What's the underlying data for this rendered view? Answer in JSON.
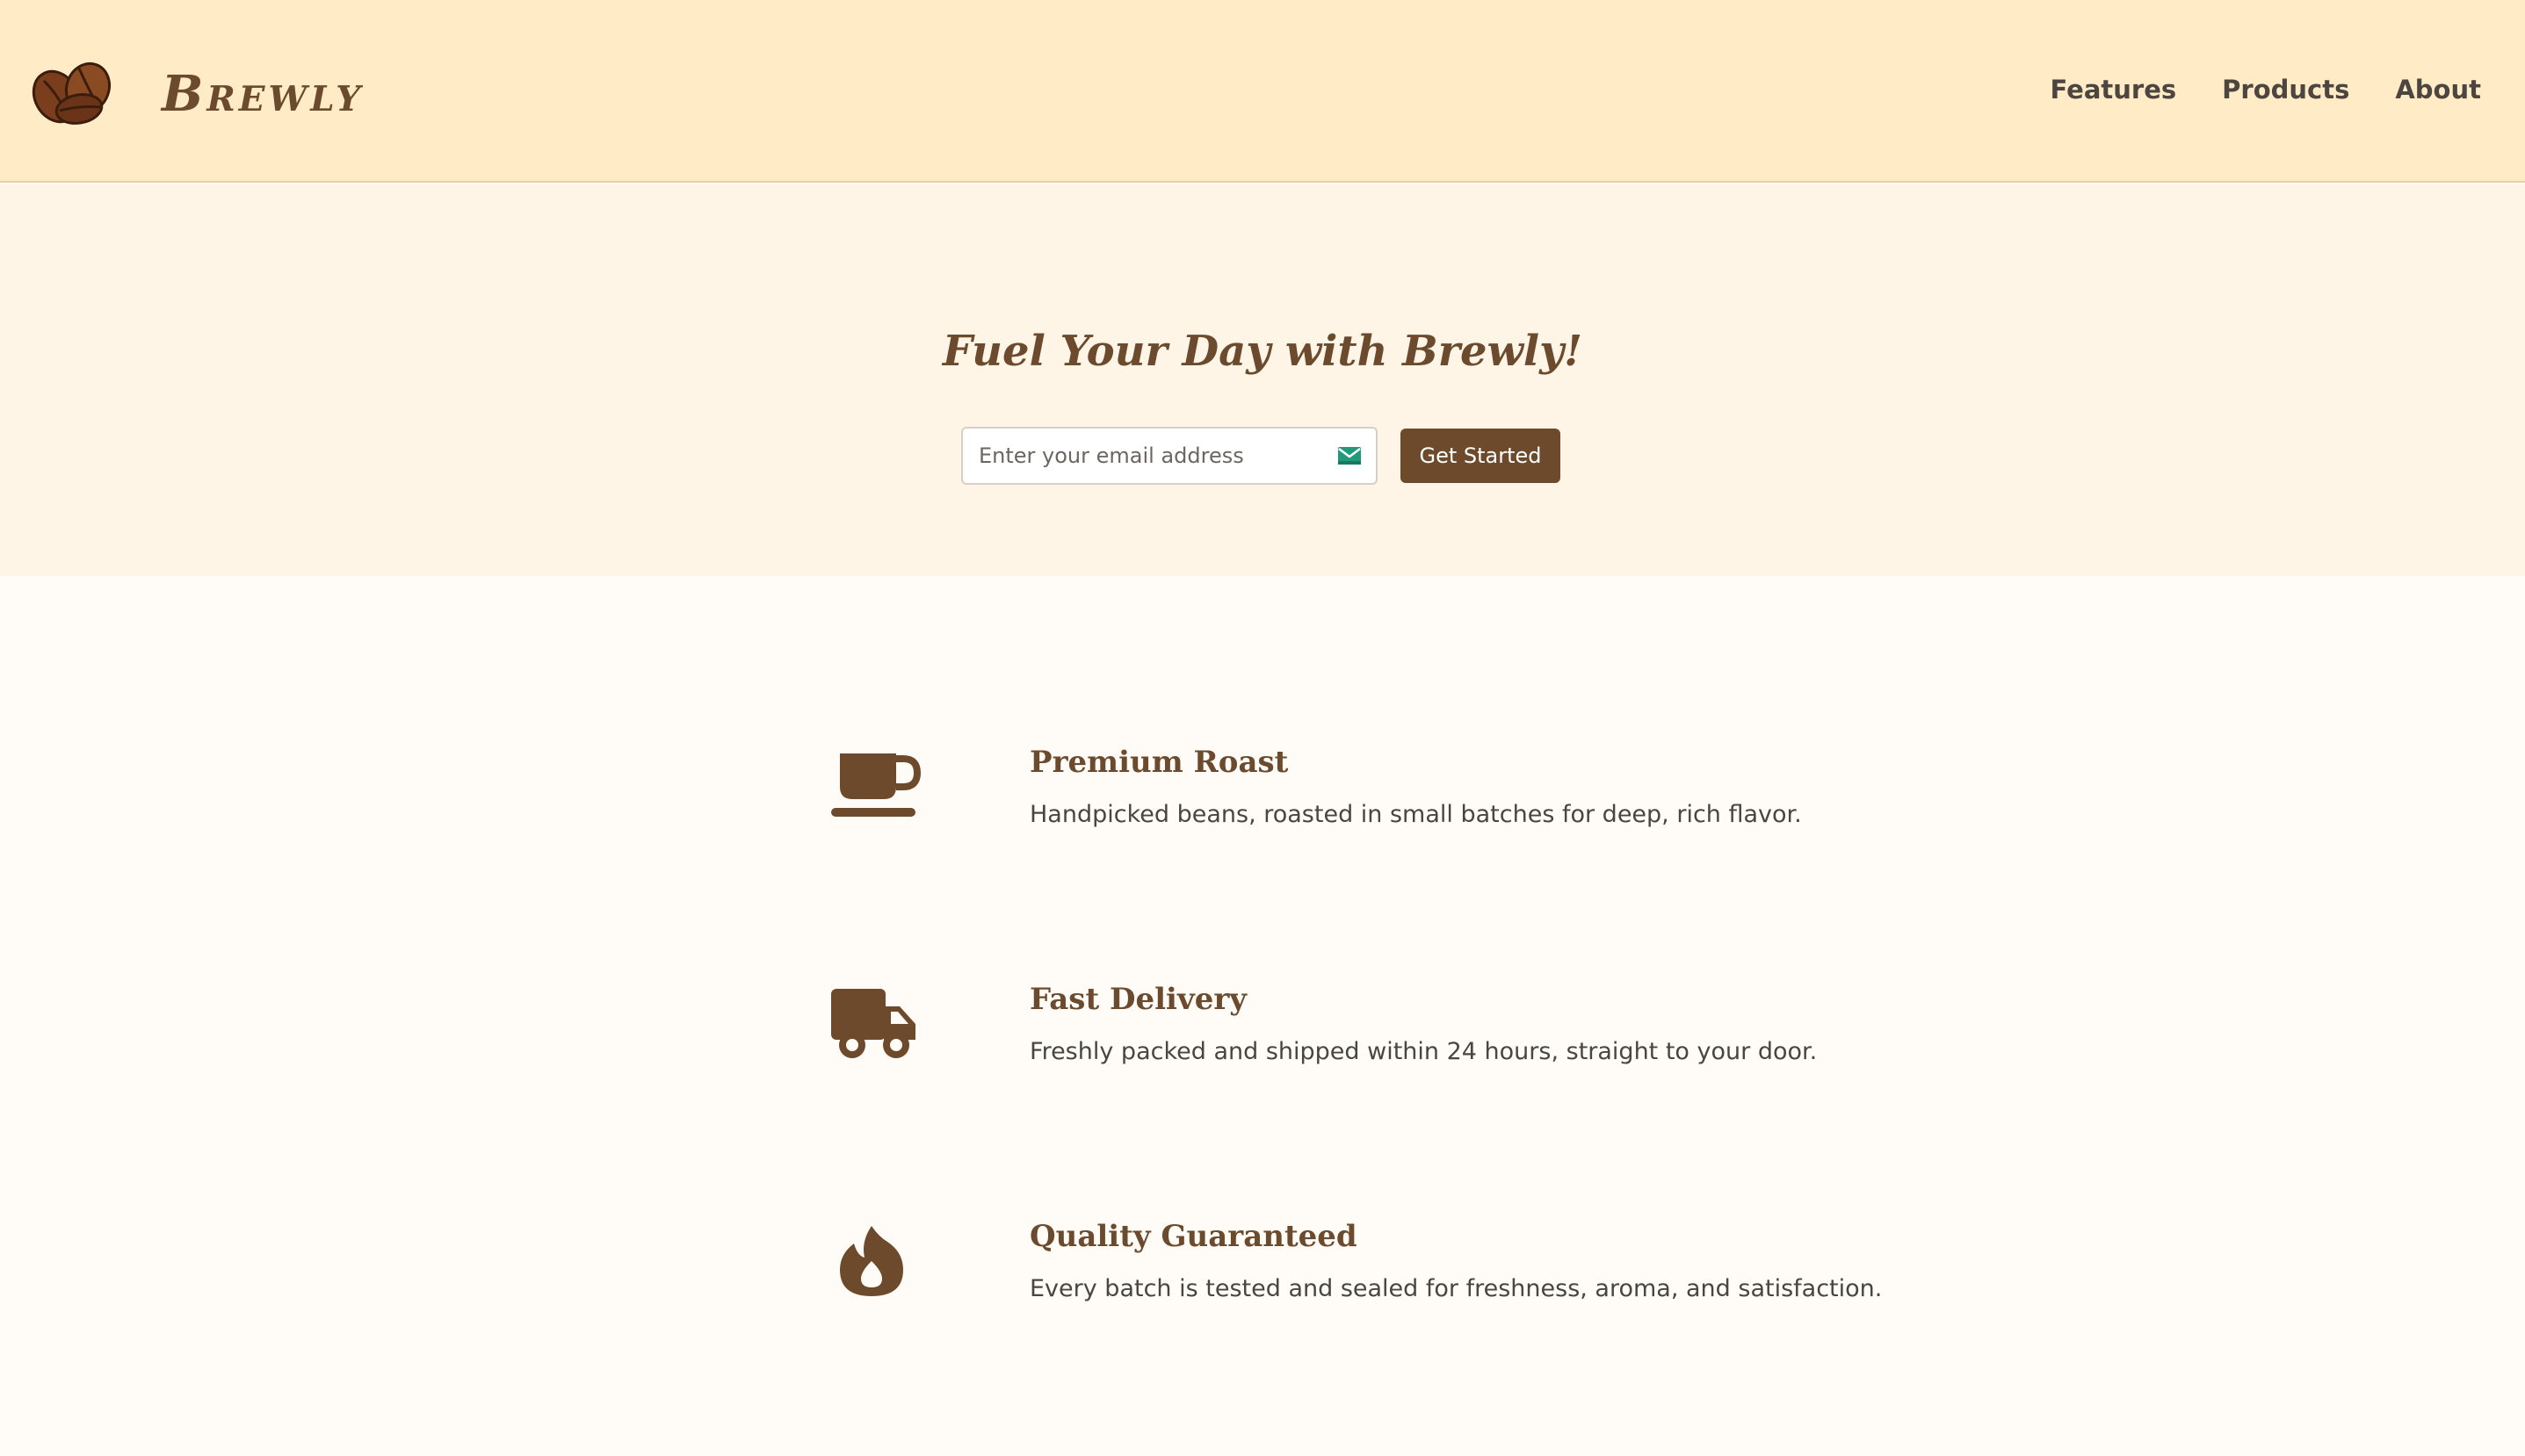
{
  "brand": {
    "name": "Brewly",
    "logo_icon": "coffee-beans-icon"
  },
  "nav": {
    "items": [
      {
        "label": "Features"
      },
      {
        "label": "Products"
      },
      {
        "label": "About"
      }
    ]
  },
  "hero": {
    "title": "Fuel Your Day with Brewly!",
    "email_placeholder": "Enter your email address",
    "email_value": "",
    "email_icon": "mail-icon",
    "cta_label": "Get Started"
  },
  "features": [
    {
      "icon": "coffee-cup-icon",
      "title": "Premium Roast",
      "description": "Handpicked beans, roasted in small batches for deep, rich flavor."
    },
    {
      "icon": "delivery-truck-icon",
      "title": "Fast Delivery",
      "description": "Freshly packed and shipped within 24 hours, straight to your door."
    },
    {
      "icon": "fire-icon",
      "title": "Quality Guaranteed",
      "description": "Every batch is tested and sealed for freshness, aroma, and satisfaction."
    }
  ],
  "colors": {
    "header_bg": "#ffecc6",
    "hero_bg": "#fff5e6",
    "page_bg": "#fffcf7",
    "accent_brown": "#6e4a2d",
    "mail_icon_green": "#1f9a7a"
  }
}
